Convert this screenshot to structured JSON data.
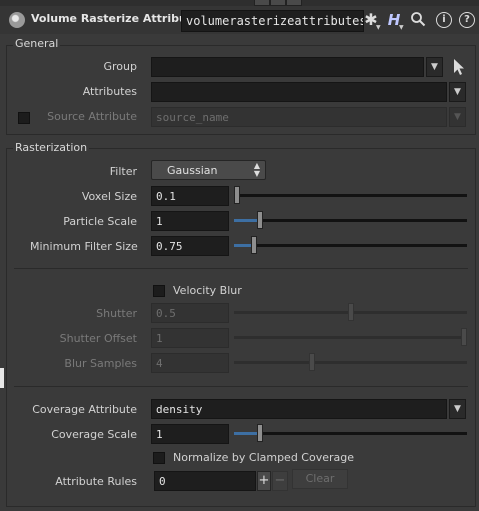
{
  "header": {
    "node_type": "Volume Rasterize Attributes",
    "node_name": "volumerasterizeattributes",
    "icons": [
      "gear-icon",
      "houdini-help-icon",
      "search-icon",
      "info-icon",
      "help-icon"
    ],
    "h_glyph": "H"
  },
  "general": {
    "title": "General",
    "group_label": "Group",
    "group_value": "",
    "attributes_label": "Attributes",
    "attributes_value": "",
    "source_attribute_label": "Source Attribute",
    "source_attribute_value": "source_name",
    "source_attribute_enabled": false
  },
  "rasterization": {
    "title": "Rasterization",
    "filter_label": "Filter",
    "filter_value": "Gaussian",
    "voxel_size_label": "Voxel Size",
    "voxel_size_value": "0.1",
    "voxel_size_fraction": 0.0,
    "particle_scale_label": "Particle Scale",
    "particle_scale_value": "1",
    "particle_scale_fraction": 0.1,
    "min_filter_size_label": "Minimum Filter Size",
    "min_filter_size_value": "0.75",
    "min_filter_size_fraction": 0.075,
    "velocity_blur_label": "Velocity Blur",
    "velocity_blur_checked": false,
    "shutter_label": "Shutter",
    "shutter_value": "0.5",
    "shutter_fraction": 0.5,
    "shutter_offset_label": "Shutter Offset",
    "shutter_offset_value": "1",
    "shutter_offset_fraction": 1.0,
    "blur_samples_label": "Blur Samples",
    "blur_samples_value": "4",
    "blur_samples_fraction": 0.33,
    "coverage_attribute_label": "Coverage Attribute",
    "coverage_attribute_value": "density",
    "coverage_scale_label": "Coverage Scale",
    "coverage_scale_value": "1",
    "coverage_scale_fraction": 0.1,
    "normalize_label": "Normalize by Clamped Coverage",
    "normalize_checked": false,
    "attribute_rules_label": "Attribute Rules",
    "attribute_rules_value": "0",
    "add_label": "+",
    "remove_label": "−",
    "clear_label": "Clear"
  },
  "colors": {
    "background": "#3a3a3a",
    "field": "#1e1e1e",
    "slider_fill": "#3d6fa3"
  }
}
